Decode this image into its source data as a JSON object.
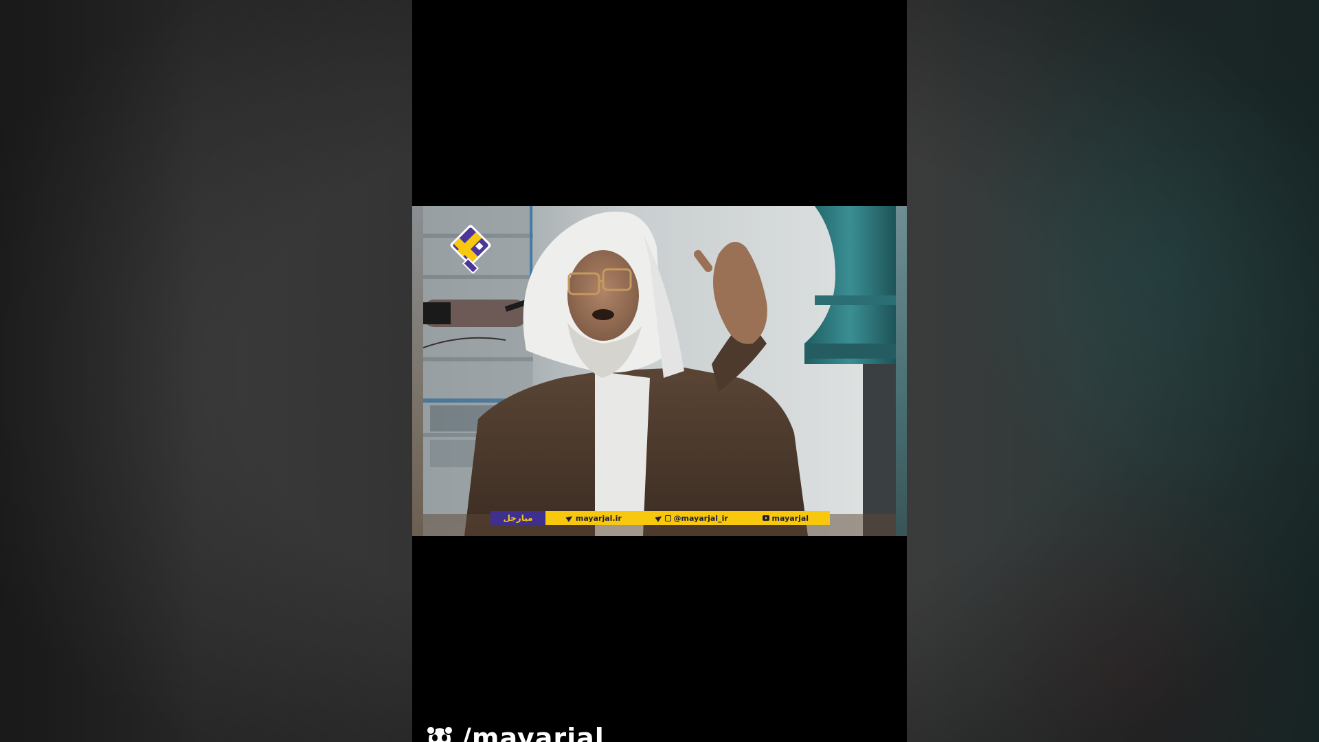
{
  "video": {
    "ticker": {
      "brand": "میارجل",
      "items": [
        {
          "icon": "send-icon",
          "text": "mayarjal.ir"
        },
        {
          "icon": "telegram-instagram-icon",
          "text": "@mayarjal_ir"
        },
        {
          "icon": "youtube-icon",
          "text": "mayarjal"
        }
      ]
    },
    "logo_icon": "mayarjal-logo"
  },
  "watermark": {
    "icon": "panda-icon",
    "text": "/mayarjal"
  },
  "colors": {
    "ticker_bar": "#f7c80e",
    "ticker_brand_bg": "#3f2f8f",
    "logo_purple": "#4b3799",
    "logo_yellow": "#f7c80e"
  }
}
